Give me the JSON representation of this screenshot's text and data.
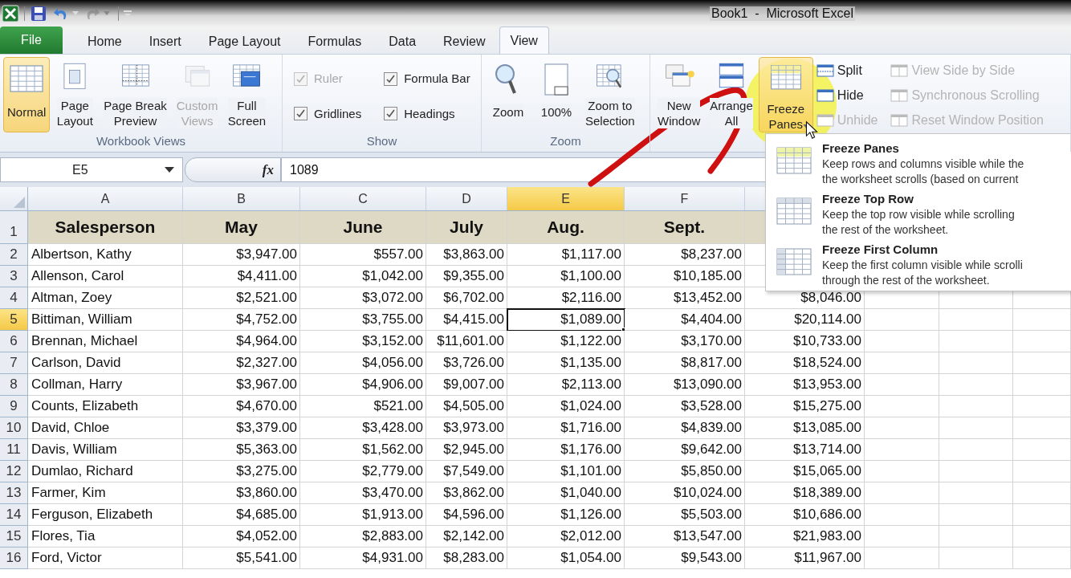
{
  "window": {
    "title": "Book1  -  Microsoft Excel"
  },
  "quick_access": [
    {
      "kind": "save",
      "disabled": false
    },
    {
      "kind": "undo",
      "disabled": false
    },
    {
      "kind": "redo",
      "disabled": true
    }
  ],
  "tabs": [
    {
      "label": "File",
      "kind": "file",
      "selected": false
    },
    {
      "label": "Home",
      "kind": "tab",
      "selected": false
    },
    {
      "label": "Insert",
      "kind": "tab",
      "selected": false
    },
    {
      "label": "Page Layout",
      "kind": "tab",
      "selected": false
    },
    {
      "label": "Formulas",
      "kind": "tab",
      "selected": false
    },
    {
      "label": "Data",
      "kind": "tab",
      "selected": false
    },
    {
      "label": "Review",
      "kind": "tab",
      "selected": false
    },
    {
      "label": "View",
      "kind": "tab",
      "selected": true
    }
  ],
  "ribbon": {
    "groups": [
      {
        "label": "Workbook Views",
        "items": [
          {
            "kind": "large",
            "lines": [
              "Normal"
            ],
            "selected": true,
            "disabled": false
          },
          {
            "kind": "large",
            "lines": [
              "Page",
              "Layout"
            ],
            "selected": false,
            "disabled": false
          },
          {
            "kind": "large",
            "lines": [
              "Page Break",
              "Preview"
            ],
            "selected": false,
            "disabled": false
          },
          {
            "kind": "large",
            "lines": [
              "Custom",
              "Views"
            ],
            "selected": false,
            "disabled": true
          },
          {
            "kind": "large",
            "lines": [
              "Full",
              "Screen"
            ],
            "selected": false,
            "disabled": false
          }
        ]
      },
      {
        "label": "Show",
        "items": [
          {
            "kind": "checkbox",
            "label": "Ruler",
            "checked": true,
            "disabled": true
          },
          {
            "kind": "checkbox",
            "label": "Formula Bar",
            "checked": true,
            "disabled": false
          },
          {
            "kind": "checkbox",
            "label": "Gridlines",
            "checked": true,
            "disabled": false
          },
          {
            "kind": "checkbox",
            "label": "Headings",
            "checked": true,
            "disabled": false
          }
        ]
      },
      {
        "label": "Zoom",
        "items": [
          {
            "kind": "large",
            "lines": [
              "Zoom"
            ],
            "selected": false,
            "disabled": false
          },
          {
            "kind": "large",
            "lines": [
              "100%"
            ],
            "selected": false,
            "disabled": false
          },
          {
            "kind": "large",
            "lines": [
              "Zoom to",
              "Selection"
            ],
            "selected": false,
            "disabled": false
          }
        ]
      },
      {
        "items": [
          {
            "kind": "large",
            "lines": [
              "New",
              "Window"
            ],
            "selected": false,
            "disabled": false
          },
          {
            "kind": "large",
            "lines": [
              "Arrange",
              "All"
            ],
            "selected": false,
            "disabled": false
          },
          {
            "kind": "dropdown",
            "lines": [
              "Freeze",
              "Panes"
            ],
            "selected": true,
            "disabled": false,
            "expanded": true
          },
          {
            "kind": "small",
            "label": "Split",
            "disabled": false
          },
          {
            "kind": "small",
            "label": "Hide",
            "disabled": false
          },
          {
            "kind": "small",
            "label": "Unhide",
            "disabled": true
          },
          {
            "kind": "small",
            "label": "View Side by Side",
            "disabled": true
          },
          {
            "kind": "small",
            "label": "Synchronous Scrolling",
            "disabled": true
          },
          {
            "kind": "small",
            "label": "Reset Window Position",
            "disabled": true
          }
        ]
      }
    ]
  },
  "freeze_menu": [
    {
      "title": "Freeze Panes",
      "lines": [
        "Keep rows and columns visible while the",
        "the worksheet scrolls (based on current"
      ]
    },
    {
      "title": "Freeze Top Row",
      "lines": [
        "Keep the top row visible while scrolling",
        "the rest of the worksheet."
      ]
    },
    {
      "title": "Freeze First Column",
      "lines": [
        "Keep the first column visible while scrolli",
        "through the rest of the worksheet."
      ]
    }
  ],
  "formula_bar": {
    "name_box": "E5",
    "fx": "fx",
    "value": "1089"
  },
  "sheet": {
    "columns": [
      {
        "label": "A",
        "selected": false
      },
      {
        "label": "B",
        "selected": false
      },
      {
        "label": "C",
        "selected": false
      },
      {
        "label": "D",
        "selected": false
      },
      {
        "label": "E",
        "selected": true
      },
      {
        "label": "F",
        "selected": false
      }
    ],
    "rows": [
      {
        "number": "1",
        "kind": "header",
        "selected": false,
        "cells": [
          "Salesperson",
          "May",
          "June",
          "July",
          "Aug.",
          "Sept."
        ]
      },
      {
        "number": "2",
        "kind": "data",
        "selected": false,
        "cells": [
          "Albertson, Kathy",
          "$3,947.00",
          "$557.00",
          "$3,863.00",
          "$1,117.00",
          "$8,237.00"
        ]
      },
      {
        "number": "3",
        "kind": "data",
        "selected": false,
        "cells": [
          "Allenson, Carol",
          "$4,411.00",
          "$1,042.00",
          "$9,355.00",
          "$1,100.00",
          "$10,185.00"
        ]
      },
      {
        "number": "4",
        "kind": "data",
        "selected": false,
        "cells": [
          "Altman, Zoey",
          "$2,521.00",
          "$3,072.00",
          "$6,702.00",
          "$2,116.00",
          "$13,452.00",
          "$8,046.00"
        ]
      },
      {
        "number": "5",
        "kind": "data",
        "selected": true,
        "cells": [
          "Bittiman, William",
          "$4,752.00",
          "$3,755.00",
          "$4,415.00",
          "$1,089.00",
          "$4,404.00",
          "$20,114.00"
        ]
      },
      {
        "number": "6",
        "kind": "data",
        "selected": false,
        "cells": [
          "Brennan, Michael",
          "$4,964.00",
          "$3,152.00",
          "$11,601.00",
          "$1,122.00",
          "$3,170.00",
          "$10,733.00"
        ]
      },
      {
        "number": "7",
        "kind": "data",
        "selected": false,
        "cells": [
          "Carlson, David",
          "$2,327.00",
          "$4,056.00",
          "$3,726.00",
          "$1,135.00",
          "$8,817.00",
          "$18,524.00"
        ]
      },
      {
        "number": "8",
        "kind": "data",
        "selected": false,
        "cells": [
          "Collman, Harry",
          "$3,967.00",
          "$4,906.00",
          "$9,007.00",
          "$2,113.00",
          "$13,090.00",
          "$13,953.00"
        ]
      },
      {
        "number": "9",
        "kind": "data",
        "selected": false,
        "cells": [
          "Counts, Elizabeth",
          "$4,670.00",
          "$521.00",
          "$4,505.00",
          "$1,024.00",
          "$3,528.00",
          "$15,275.00"
        ]
      },
      {
        "number": "10",
        "kind": "data",
        "selected": false,
        "cells": [
          "David, Chloe",
          "$3,379.00",
          "$3,428.00",
          "$3,973.00",
          "$1,716.00",
          "$4,839.00",
          "$13,085.00"
        ]
      },
      {
        "number": "11",
        "kind": "data",
        "selected": false,
        "cells": [
          "Davis, William",
          "$5,363.00",
          "$1,562.00",
          "$2,945.00",
          "$1,176.00",
          "$9,642.00",
          "$13,714.00"
        ]
      },
      {
        "number": "12",
        "kind": "data",
        "selected": false,
        "cells": [
          "Dumlao, Richard",
          "$3,275.00",
          "$2,779.00",
          "$7,549.00",
          "$1,101.00",
          "$5,850.00",
          "$15,065.00"
        ]
      },
      {
        "number": "13",
        "kind": "data",
        "selected": false,
        "cells": [
          "Farmer, Kim",
          "$3,860.00",
          "$3,470.00",
          "$3,862.00",
          "$1,040.00",
          "$10,024.00",
          "$18,389.00"
        ]
      },
      {
        "number": "14",
        "kind": "data",
        "selected": false,
        "cells": [
          "Ferguson, Elizabeth",
          "$4,685.00",
          "$1,913.00",
          "$4,596.00",
          "$1,126.00",
          "$5,503.00",
          "$10,686.00"
        ]
      },
      {
        "number": "15",
        "kind": "data",
        "selected": false,
        "cells": [
          "Flores, Tia",
          "$4,052.00",
          "$2,883.00",
          "$2,142.00",
          "$2,012.00",
          "$13,547.00",
          "$21,983.00"
        ]
      },
      {
        "number": "16",
        "kind": "data",
        "selected": false,
        "cells": [
          "Ford, Victor",
          "$5,541.00",
          "$4,931.00",
          "$8,283.00",
          "$1,054.00",
          "$9,543.00",
          "$11,967.00"
        ]
      }
    ]
  }
}
